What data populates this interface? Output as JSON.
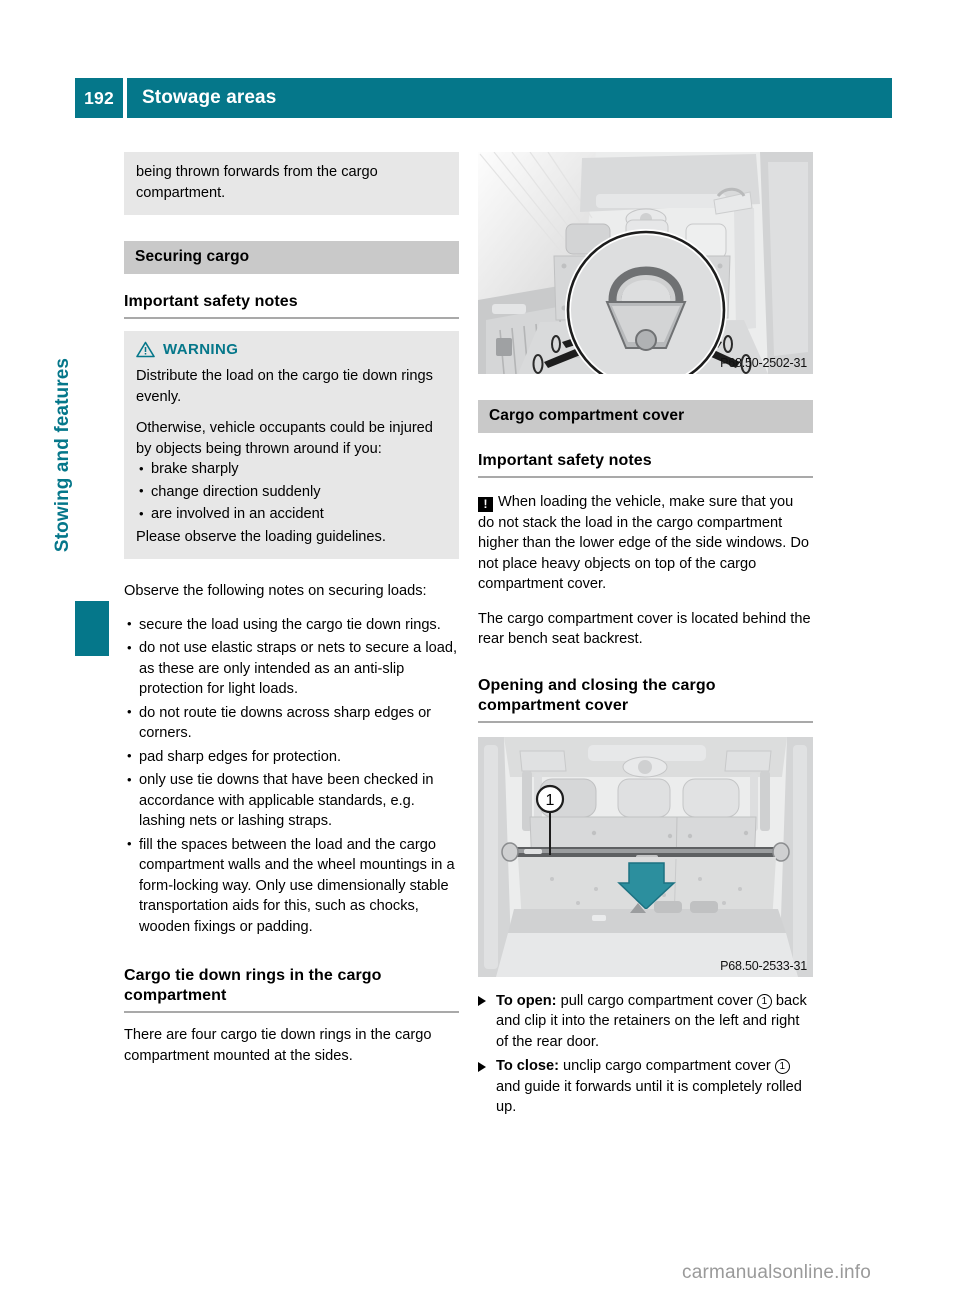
{
  "header": {
    "page_number": "192",
    "title": "Stowage areas"
  },
  "side_tab": {
    "label": "Stowing and features"
  },
  "left_column": {
    "continued_warning": {
      "text": "being thrown forwards from the cargo compartment."
    },
    "section_head": "Securing cargo",
    "sub_head": "Important safety notes",
    "warning": {
      "icon": "warning-triangle-icon",
      "label": "WARNING",
      "para1": "Distribute the load on the cargo tie down rings evenly.",
      "para2": "Otherwise, vehicle occupants could be injured by objects being thrown around if you:",
      "bullets": [
        "brake sharply",
        "change direction suddenly",
        "are involved in an accident"
      ],
      "para3": "Please observe the loading guidelines."
    },
    "intro": "Observe the following notes on securing loads:",
    "notes": [
      "secure the load using the cargo tie down rings.",
      "do not use elastic straps or nets to secure a load, as these are only intended as an anti-slip protection for light loads.",
      "do not route tie downs across sharp edges or corners.",
      "pad sharp edges for protection.",
      "only use tie downs that have been checked in accordance with applicable standards, e.g. lashing nets or lashing straps.",
      "fill the spaces between the load and the cargo compartment walls and the wheel mountings in a form-locking way. Only use dimensionally stable transportation aids for this, such as chocks, wooden fixings or padding."
    ],
    "tie_down_head": "Cargo tie down rings in the cargo compartment",
    "tie_down_text": "There are four cargo tie down rings in the cargo compartment mounted at the sides."
  },
  "right_column": {
    "figure_top": {
      "name": "cargo-tie-down-ring-illustration",
      "caption": "P68.50-2502-31"
    },
    "section_head": "Cargo compartment cover",
    "sub_head": "Important safety notes",
    "notice": {
      "icon": "exclamation-notice-icon",
      "text": "When loading the vehicle, make sure that you do not stack the load in the cargo compartment higher than the lower edge of the side windows. Do not place heavy objects on top of the cargo compartment cover."
    },
    "location_text": "The cargo compartment cover is located behind the rear bench seat backrest.",
    "opening_head": "Opening and closing the cargo compartment cover",
    "figure_bottom": {
      "name": "cargo-compartment-cover-illustration",
      "caption": "P68.50-2533-31",
      "callout": "1"
    },
    "steps": [
      {
        "label": "To open:",
        "text_before": " pull cargo compartment cover ",
        "callout": "1",
        "text_after": " back and clip it into the retainers on the left and right of the rear door."
      },
      {
        "label": "To close:",
        "text_before": " unclip cargo compartment cover ",
        "callout": "1",
        "text_after": " and guide it forwards until it is completely rolled up."
      }
    ]
  },
  "footer": {
    "watermark": "carmanualsonline.info"
  },
  "colors": {
    "teal": "#05778a",
    "section_head_gray": "#c9c9c9",
    "warning_box_gray": "#e7e7e7",
    "rule_gray": "#a9a9a9"
  }
}
